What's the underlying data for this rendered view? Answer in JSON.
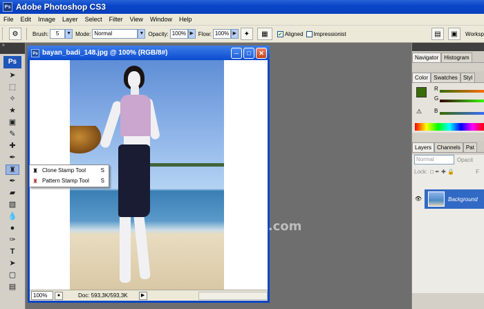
{
  "app": {
    "title": "Adobe Photoshop CS3",
    "logo_text": "Ps"
  },
  "menu": [
    "File",
    "Edit",
    "Image",
    "Layer",
    "Select",
    "Filter",
    "View",
    "Window",
    "Help"
  ],
  "options": {
    "brush_label": "Brush:",
    "brush_size": "5",
    "mode_label": "Mode:",
    "mode_value": "Normal",
    "opacity_label": "Opacity:",
    "opacity_value": "100%",
    "flow_label": "Flow:",
    "flow_value": "100%",
    "aligned_label": "Aligned",
    "aligned_checked": true,
    "impressionist_label": "Impressionist",
    "impressionist_checked": false,
    "workspace_label": "Worksp"
  },
  "toolbox": {
    "logo": "Ps",
    "tools": [
      "move",
      "marquee",
      "lasso",
      "magic-wand",
      "crop",
      "slice",
      "healing-brush",
      "brush",
      "stamp",
      "history-brush",
      "eraser",
      "gradient",
      "blur",
      "dodge",
      "pen",
      "type",
      "path-selection",
      "shape",
      "notes",
      "eyedropper"
    ]
  },
  "document": {
    "title": "bayan_badi_148.jpg @ 100% (RGB/8#)",
    "zoom": "100%",
    "doc_info": "Doc: 593,3K/593,3K",
    "window_controls": [
      "minimize",
      "maximize",
      "close"
    ]
  },
  "flyout": {
    "items": [
      {
        "label": "Clone Stamp Tool",
        "key": "S",
        "icon": "clone-stamp-icon"
      },
      {
        "label": "Pattern Stamp Tool",
        "key": "S",
        "icon": "pattern-stamp-icon"
      }
    ]
  },
  "watermark": "ers.com",
  "panels": {
    "nav_tabs": [
      "Navigator",
      "Histogram"
    ],
    "color_tabs": [
      "Color",
      "Swatches",
      "Styl"
    ],
    "color_channels": [
      "R",
      "G",
      "B"
    ],
    "colors": {
      "foreground": "#3a6c07",
      "background": "#ffffff"
    },
    "layer_tabs": [
      "Layers",
      "Channels",
      "Pat"
    ],
    "blend_mode": "Normal",
    "opacity_label": "Opacit",
    "lock_label": "Lock:",
    "fill_label": "F",
    "layer_name": "Background"
  }
}
